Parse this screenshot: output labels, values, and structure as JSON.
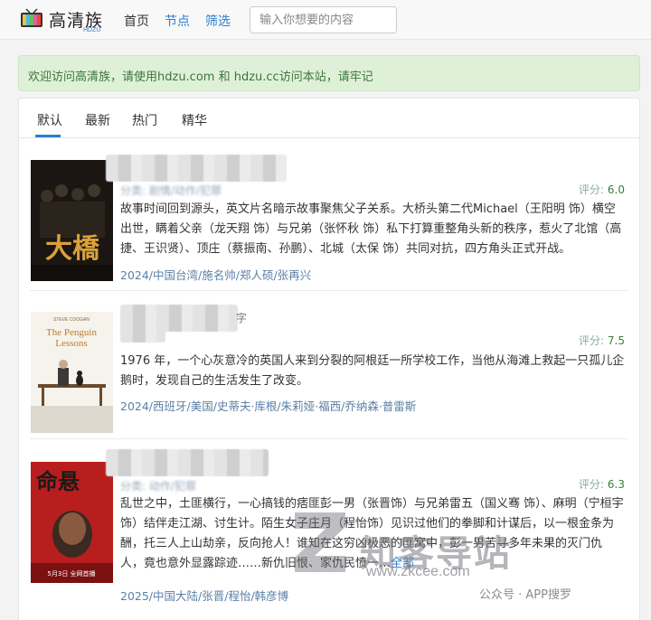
{
  "nav": {
    "logo_text": "高清族",
    "logo_sub": "HDZU",
    "links": [
      "首页",
      "节点",
      "筛选"
    ],
    "search_placeholder": "输入你想要的内容"
  },
  "notice": "欢迎访问高清族，请使用hdzu.com 和 hdzu.cc访问本站，请牢记",
  "tabs": [
    "默认",
    "最新",
    "热门",
    "精华"
  ],
  "rating_label": "评分:",
  "items": [
    {
      "meta": "分类: 剧情/动作/犯罪",
      "rating": "6.0",
      "desc": "故事时间回到源头，英文片名暗示故事聚焦父子关系。大桥头第二代Michael（王阳明 饰）横空出世，瞒着父亲（龙天翔 饰）与兄弟（张怀秋 饰）私下打算重整角头新的秩序，惹火了北馆（高捷、王识贤）、顶庄（蔡振南、孙鹏）、北城（太保 饰）共同对抗，四方角头正式开战。",
      "tags": "2024/中国台湾/施名帅/郑人硕/张再兴"
    },
    {
      "title_tail": "字",
      "poster_title": "The Penguin Lessons",
      "poster_top": "STEVE COOGAN",
      "rating": "7.5",
      "desc": "1976 年，一个心灰意冷的英国人来到分裂的阿根廷一所学校工作，当他从海滩上救起一只孤儿企鹅时，发现自己的生活发生了改变。",
      "tags": "2024/西班牙/美国/史蒂夫·库根/朱莉娅·福西/乔纳森·普雷斯"
    },
    {
      "meta": "分类: 动作/犯罪",
      "rating": "6.3",
      "poster_badge": "5月3日 全网首播",
      "desc": "乱世之中，土匪横行，一心搞钱的痞匪彭一男（张晋饰）与兄弟雷五（国义骞 饰）、麻明（宁桓宇 饰）结伴走江湖、讨生计。陌生女子庄月（程怡饰）见识过他们的拳脚和计谋后，以一根金条为酬，托三人上山劫亲，反向抢人！谁知在这穷凶极恶的匪窝中，彭一男苦寻多年未果的灭门仇人，竟也意外显露踪迹……新仇旧恨、家仇民愤一…",
      "more": "全部",
      "tags": "2025/中国大陆/张晋/程怡/韩彦博"
    }
  ],
  "watermark": {
    "brand": "知客导站",
    "url": "www.zkcee.com",
    "wechat": "公众号 · APP搜罗"
  },
  "colors": {
    "link": "#2a7fd4",
    "notice_bg": "#dff0d8",
    "notice_text": "#3c763d",
    "rating": "#3c7d3c"
  }
}
